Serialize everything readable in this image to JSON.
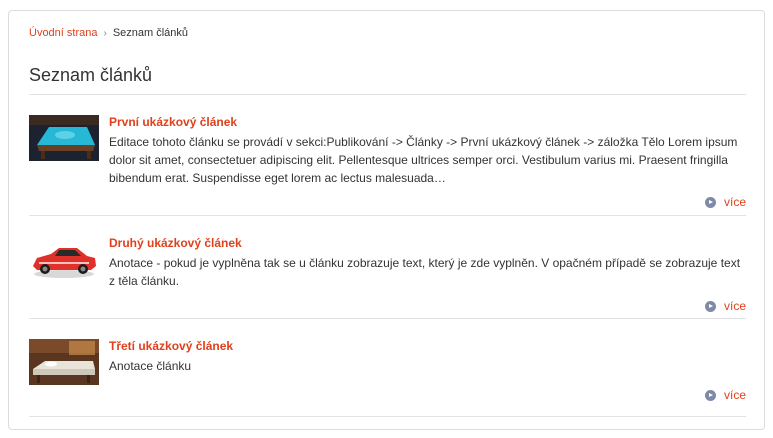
{
  "breadcrumb": {
    "home": "Úvodní strana",
    "separator": "›",
    "current": "Seznam článků"
  },
  "page": {
    "title": "Seznam článků"
  },
  "articles": [
    {
      "title": "První ukázkový článek",
      "text": "Editace tohoto článku se provádí v sekci:Publikování -> Články -> První ukázkový článek -> záložka Tělo Lorem ipsum dolor sit amet, consectetuer adipiscing elit. Pellentesque ultrices semper orci. Vestibulum varius mi. Praesent fringilla bibendum erat. Suspendisse eget lorem ac lectus malesuada…",
      "more": "více",
      "image": "pool-table-photo"
    },
    {
      "title": "Druhý ukázkový článek",
      "text": "Anotace - pokud je vyplněna tak se u článku zobrazuje text, který je zde vyplněn. V opačném případě se zobrazuje text z těla článku.",
      "more": "více",
      "image": "red-car-photo"
    },
    {
      "title": "Třetí ukázkový článek",
      "text": "Anotace článku",
      "more": "více",
      "image": "massage-bed-photo"
    }
  ],
  "colors": {
    "accent": "#e0401b",
    "text": "#333333",
    "border": "#dcdcdc",
    "more_icon": "#7f8aa6"
  }
}
